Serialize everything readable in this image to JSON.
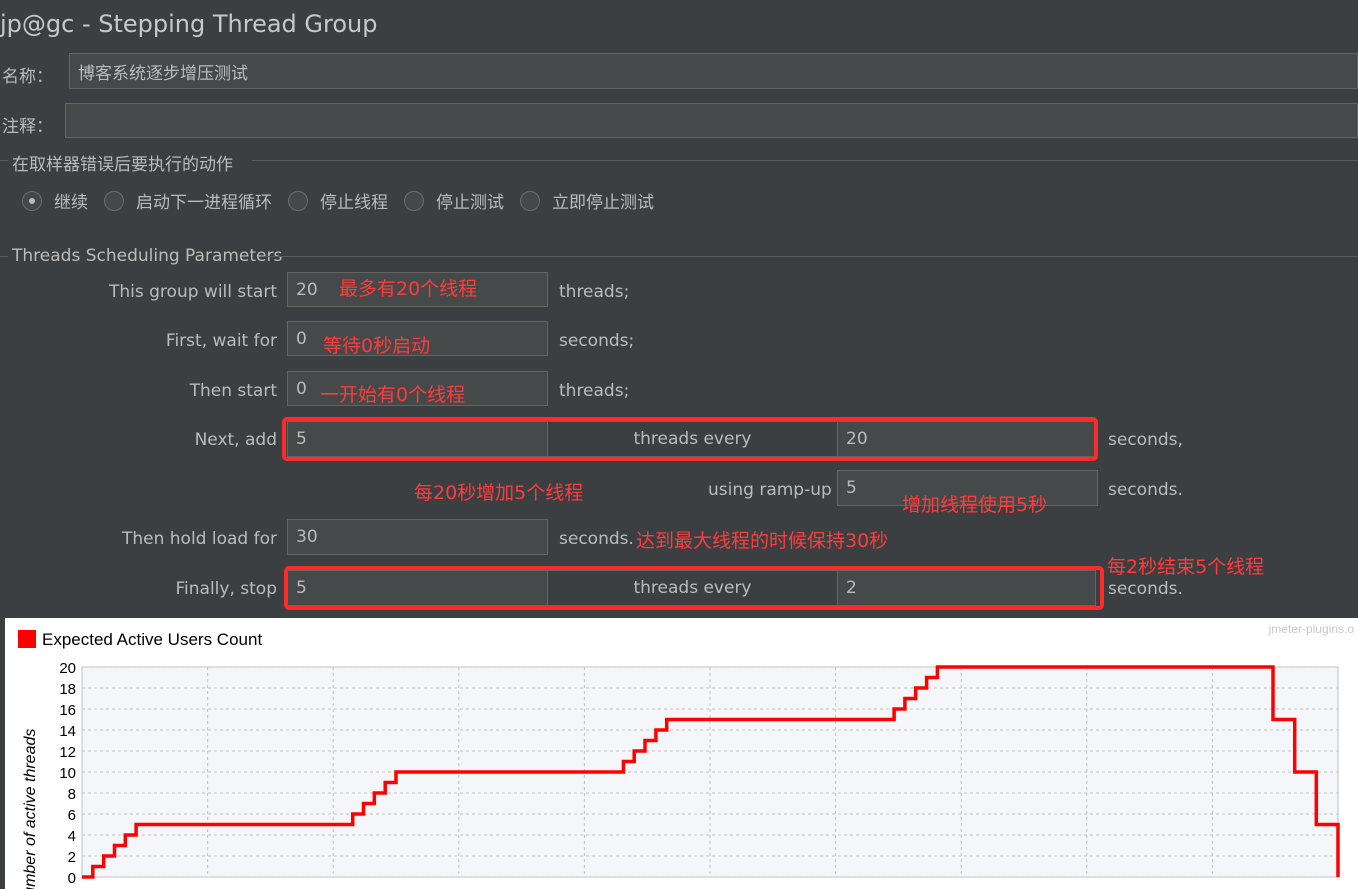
{
  "window": {
    "title": "jp@gc - Stepping Thread Group"
  },
  "name_row": {
    "label": "名称：",
    "value": "博客系统逐步增压测试"
  },
  "comment_row": {
    "label": "注释：",
    "value": ""
  },
  "error_action": {
    "legend": "在取样器错误后要执行的动作",
    "options": [
      "继续",
      "启动下一进程循环",
      "停止线程",
      "停止测试",
      "立即停止测试"
    ],
    "selected": "继续"
  },
  "scheduling": {
    "legend": "Threads Scheduling Parameters",
    "start_label": "This group will start",
    "start_value": "20",
    "start_suffix": "threads;",
    "wait_label": "First, wait for",
    "wait_value": "0",
    "wait_suffix": "seconds;",
    "then_start_label": "Then start",
    "then_start_value": "0",
    "then_start_suffix": "threads;",
    "next_add_label": "Next, add",
    "next_add_value": "5",
    "next_add_mid": "threads every",
    "next_add_every": "20",
    "next_add_suffix": "seconds,",
    "rampup_label": "using ramp-up",
    "rampup_value": "5",
    "rampup_suffix": "seconds.",
    "hold_label": "Then hold load for",
    "hold_value": "30",
    "hold_suffix": "seconds.",
    "stop_label": "Finally, stop",
    "stop_value": "5",
    "stop_mid": "threads every",
    "stop_every": "2",
    "stop_suffix": "seconds."
  },
  "annotations": {
    "max_threads": "最多有20个线程",
    "wait": "等待0秒启动",
    "initial": "一开始有0个线程",
    "add_every": "每20秒增加5个线程",
    "rampup": "增加线程使用5秒",
    "hold": "达到最大线程的时候保持30秒",
    "stop": "每2秒结束5个线程"
  },
  "colors": {
    "annotation": "#ff2a2a",
    "series": "#ff0000",
    "background": "#3c3f41"
  },
  "chart_data": {
    "type": "line",
    "title": "",
    "legend": [
      "Expected Active Users Count"
    ],
    "watermark": "jmeter-plugins.o",
    "xlabel": "",
    "ylabel": "Number of active threads",
    "ylim": [
      0,
      20
    ],
    "yticks": [
      0,
      2,
      4,
      6,
      8,
      10,
      12,
      14,
      16,
      18,
      20
    ],
    "grid": true,
    "series": [
      {
        "name": "Expected Active Users Count",
        "x": [
          0,
          1,
          1,
          2,
          2,
          3,
          3,
          4,
          4,
          5,
          5,
          25,
          25,
          26,
          26,
          27,
          27,
          28,
          28,
          29,
          29,
          30,
          30,
          50,
          50,
          51,
          51,
          52,
          52,
          53,
          53,
          54,
          54,
          55,
          55,
          75,
          75,
          76,
          76,
          77,
          77,
          78,
          78,
          79,
          79,
          80,
          80,
          110,
          110,
          112,
          112,
          114,
          114,
          116,
          116
        ],
        "values": [
          0,
          0,
          1,
          1,
          2,
          2,
          3,
          3,
          4,
          4,
          5,
          5,
          6,
          6,
          7,
          7,
          8,
          8,
          9,
          9,
          10,
          10,
          10,
          10,
          11,
          11,
          12,
          12,
          13,
          13,
          14,
          14,
          15,
          15,
          15,
          15,
          16,
          16,
          17,
          17,
          18,
          18,
          19,
          19,
          20,
          20,
          20,
          20,
          15,
          15,
          10,
          10,
          5,
          5,
          0
        ]
      }
    ]
  }
}
